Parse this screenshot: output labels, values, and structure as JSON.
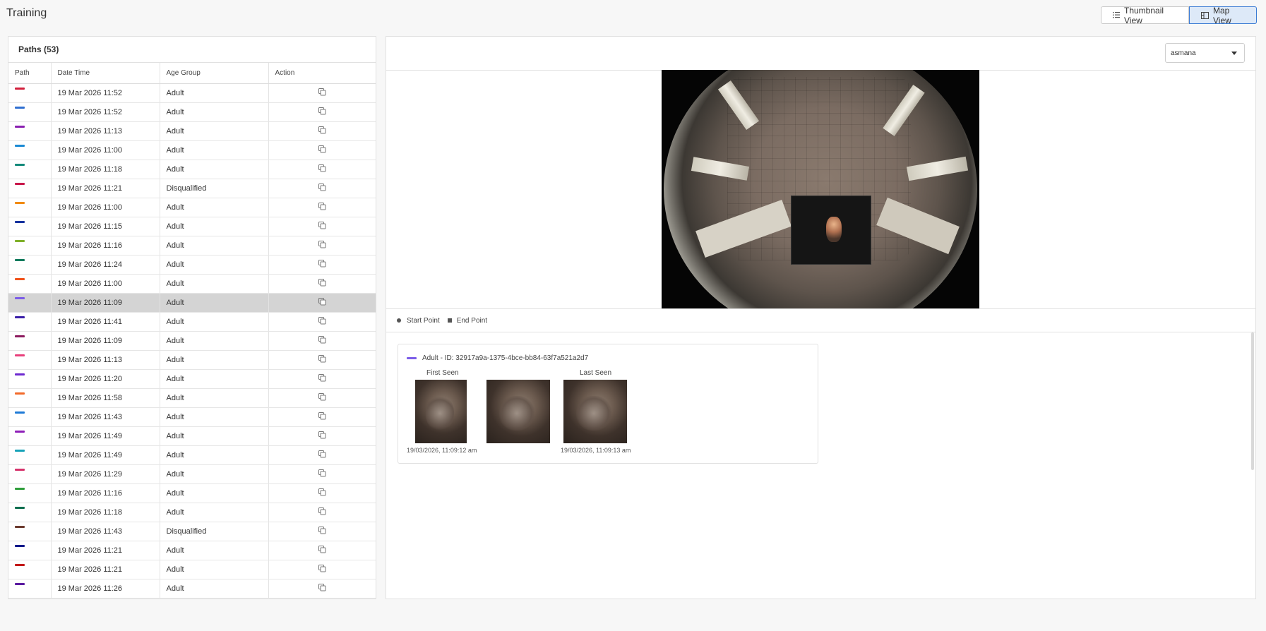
{
  "page": {
    "title": "Training"
  },
  "view_toggle": {
    "thumbnail_label": "Thumbnail View",
    "map_label": "Map View",
    "active": "map"
  },
  "paths_panel": {
    "title": "Paths (53)",
    "columns": [
      "Path",
      "Date Time",
      "Age Group",
      "Action"
    ],
    "rows": [
      {
        "color": "#d21f3c",
        "datetime": "19 Mar 2026 11:52",
        "age": "Adult"
      },
      {
        "color": "#2f6fd1",
        "datetime": "19 Mar 2026 11:52",
        "age": "Adult"
      },
      {
        "color": "#8a1fb0",
        "datetime": "19 Mar 2026 11:13",
        "age": "Adult"
      },
      {
        "color": "#1a8ad4",
        "datetime": "19 Mar 2026 11:00",
        "age": "Adult"
      },
      {
        "color": "#13897a",
        "datetime": "19 Mar 2026 11:18",
        "age": "Adult"
      },
      {
        "color": "#c8164a",
        "datetime": "19 Mar 2026 11:21",
        "age": "Disqualified"
      },
      {
        "color": "#f08a12",
        "datetime": "19 Mar 2026 11:00",
        "age": "Adult"
      },
      {
        "color": "#16329e",
        "datetime": "19 Mar 2026 11:15",
        "age": "Adult"
      },
      {
        "color": "#7fb02a",
        "datetime": "19 Mar 2026 11:16",
        "age": "Adult"
      },
      {
        "color": "#127a5c",
        "datetime": "19 Mar 2026 11:24",
        "age": "Adult"
      },
      {
        "color": "#f0521a",
        "datetime": "19 Mar 2026 11:00",
        "age": "Adult"
      },
      {
        "color": "#7b5ce8",
        "datetime": "19 Mar 2026 11:09",
        "age": "Adult",
        "selected": true
      },
      {
        "color": "#3a1ea8",
        "datetime": "19 Mar 2026 11:41",
        "age": "Adult"
      },
      {
        "color": "#8c1a5e",
        "datetime": "19 Mar 2026 11:09",
        "age": "Adult"
      },
      {
        "color": "#e8407c",
        "datetime": "19 Mar 2026 11:13",
        "age": "Adult"
      },
      {
        "color": "#6e2ad0",
        "datetime": "19 Mar 2026 11:20",
        "age": "Adult"
      },
      {
        "color": "#f26a2a",
        "datetime": "19 Mar 2026 11:58",
        "age": "Adult"
      },
      {
        "color": "#1e7ad6",
        "datetime": "19 Mar 2026 11:43",
        "age": "Adult"
      },
      {
        "color": "#8e1fb8",
        "datetime": "19 Mar 2026 11:49",
        "age": "Adult"
      },
      {
        "color": "#16a2b8",
        "datetime": "19 Mar 2026 11:49",
        "age": "Adult"
      },
      {
        "color": "#d6336c",
        "datetime": "19 Mar 2026 11:29",
        "age": "Adult"
      },
      {
        "color": "#2e9e3a",
        "datetime": "19 Mar 2026 11:16",
        "age": "Adult"
      },
      {
        "color": "#0e6e4e",
        "datetime": "19 Mar 2026 11:18",
        "age": "Adult"
      },
      {
        "color": "#6b3a2e",
        "datetime": "19 Mar 2026 11:43",
        "age": "Disqualified"
      },
      {
        "color": "#10188a",
        "datetime": "19 Mar 2026 11:21",
        "age": "Adult"
      },
      {
        "color": "#c21818",
        "datetime": "19 Mar 2026 11:21",
        "age": "Adult"
      },
      {
        "color": "#5a1aa0",
        "datetime": "19 Mar 2026 11:26",
        "age": "Adult"
      }
    ]
  },
  "map_panel": {
    "camera_select": "asmana",
    "legend": {
      "start": "Start Point",
      "end": "End Point"
    },
    "detail": {
      "title": "Adult - ID: 32917a9a-1375-4bce-bb84-63f7a521a2d7",
      "line_color": "#7b5ce8",
      "first_seen_label": "First Seen",
      "last_seen_label": "Last Seen",
      "first_seen_time": "19/03/2026, 11:09:12 am",
      "last_seen_time": "19/03/2026, 11:09:13 am"
    }
  }
}
